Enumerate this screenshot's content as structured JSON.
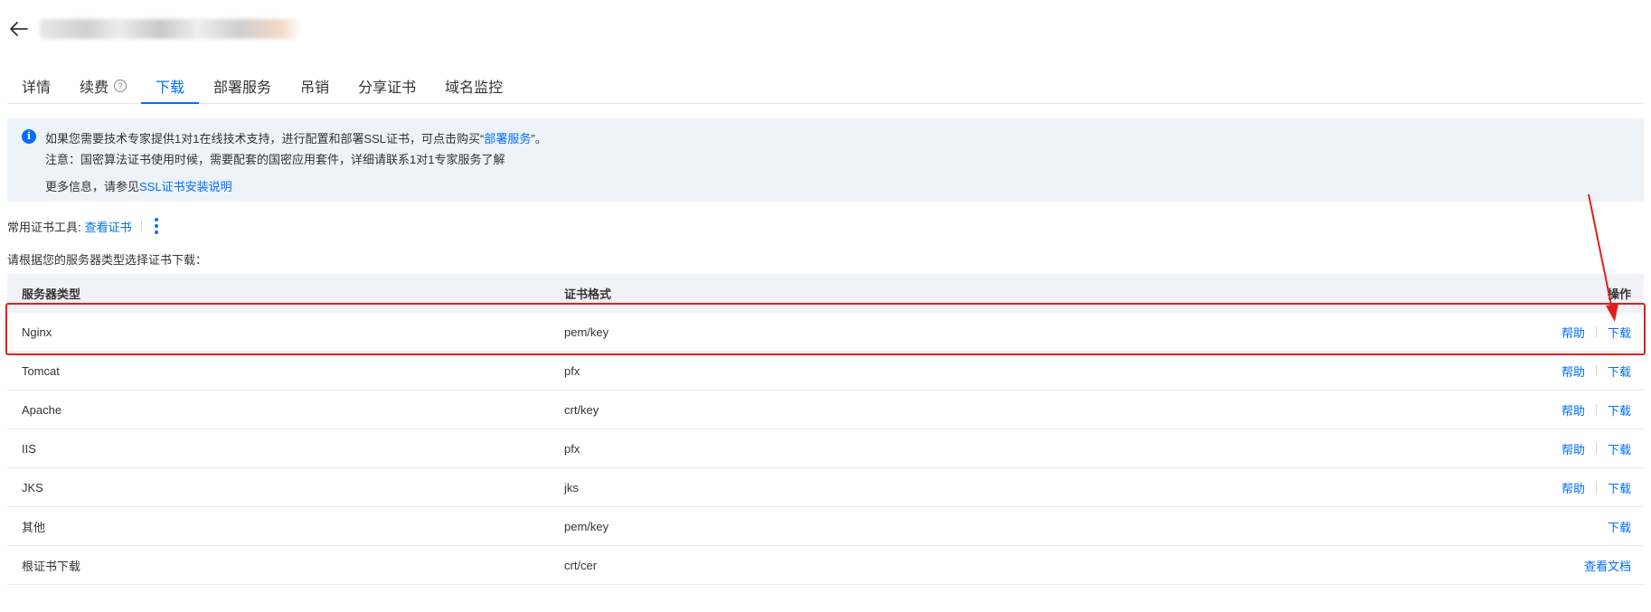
{
  "tabs": [
    "详情",
    "续费",
    "下载",
    "部署服务",
    "吊销",
    "分享证书",
    "域名监控"
  ],
  "active_tab": "下载",
  "notice": {
    "line1_prefix": "如果您需要技术专家提供1对1在线技术支持，进行配置和部署SSL证书，可点击购买“",
    "line1_link": "部署服务",
    "line1_suffix": "”。",
    "line2": "注意：国密算法证书使用时候，需要配套的国密应用套件，详细请联系1对1专家服务了解",
    "line3_prefix": "更多信息，请参见",
    "line3_link": "SSL证书安装说明"
  },
  "tools": {
    "label": "常用证书工具:",
    "view_cert": "查看证书"
  },
  "instruction": "请根据您的服务器类型选择证书下载：",
  "table": {
    "headers": {
      "server_type": "服务器类型",
      "cert_format": "证书格式",
      "action": "操作"
    },
    "rows": [
      {
        "server": "Nginx",
        "format": "pem/key",
        "help": "帮助",
        "download": "下载"
      },
      {
        "server": "Tomcat",
        "format": "pfx",
        "help": "帮助",
        "download": "下载"
      },
      {
        "server": "Apache",
        "format": "crt/key",
        "help": "帮助",
        "download": "下载"
      },
      {
        "server": "IIS",
        "format": "pfx",
        "help": "帮助",
        "download": "下载"
      },
      {
        "server": "JKS",
        "format": "jks",
        "help": "帮助",
        "download": "下载"
      },
      {
        "server": "其他",
        "format": "pem/key",
        "help": "",
        "download": "下载"
      },
      {
        "server": "根证书下载",
        "format": "crt/cer",
        "help": "",
        "download": "查看文档"
      }
    ]
  },
  "colors": {
    "accent": "#006eff",
    "annotation": "#e0201b"
  },
  "icons": {
    "back": "back-arrow-icon",
    "help": "question-circle-icon",
    "info": "info-circle-icon",
    "more": "more-vertical-icon"
  }
}
